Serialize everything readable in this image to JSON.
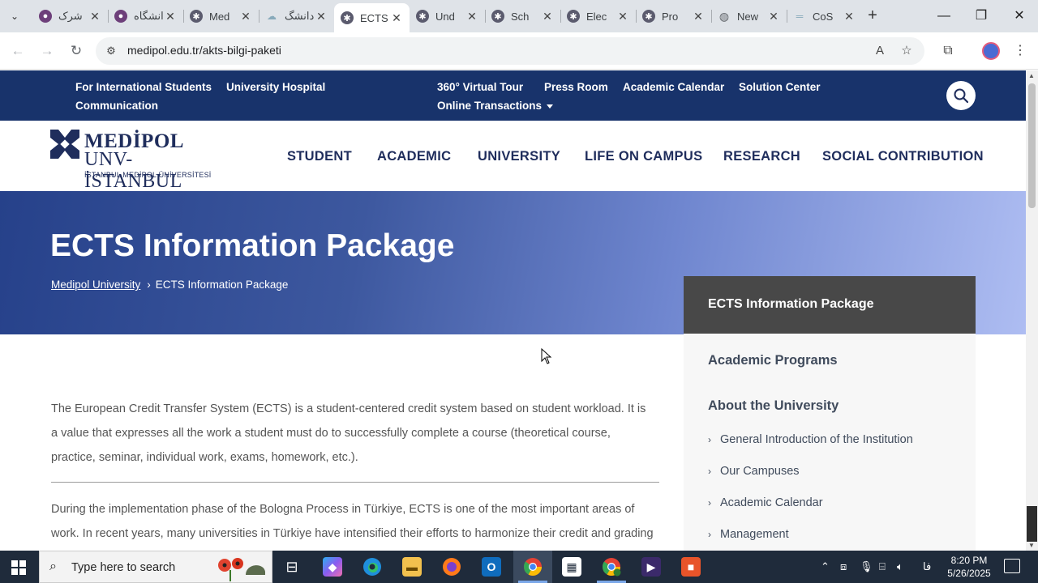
{
  "browser": {
    "tabs": [
      {
        "title": "شرک",
        "favicon": "medipol-purple-icon",
        "active": false
      },
      {
        "title": "دانشگاه",
        "favicon": "medipol-purple-icon",
        "active": false
      },
      {
        "title": "Med",
        "favicon": "medipol-icon",
        "active": false
      },
      {
        "title": "دانشگ",
        "favicon": "generic-page-icon",
        "active": false
      },
      {
        "title": "ECTS",
        "favicon": "medipol-icon",
        "active": true
      },
      {
        "title": "Und",
        "favicon": "medipol-icon",
        "active": false
      },
      {
        "title": "Sch",
        "favicon": "medipol-icon",
        "active": false
      },
      {
        "title": "Elec",
        "favicon": "medipol-icon",
        "active": false
      },
      {
        "title": "Pro",
        "favicon": "medipol-icon",
        "active": false
      },
      {
        "title": "New",
        "favicon": "globe-icon",
        "active": false
      },
      {
        "title": "CoS",
        "favicon": "line-icon",
        "active": false
      }
    ],
    "url": "medipol.edu.tr/akts-bilgi-paketi"
  },
  "site": {
    "topbar": {
      "links": [
        "For International Students",
        "University Hospital",
        "360° Virtual Tour",
        "Press Room",
        "Academic Calendar",
        "Solution Center",
        "Communication",
        "Online Transactions"
      ]
    },
    "logo": {
      "line1": "MEDİPOL",
      "line2": "UNV-İSTANBUL",
      "line3": "İSTANBUL MEDİPOL ÜNİVERSİTESİ"
    },
    "mainnav": [
      "STUDENT",
      "ACADEMIC",
      "UNIVERSITY",
      "LIFE ON CAMPUS",
      "RESEARCH",
      "SOCIAL CONTRIBUTION"
    ],
    "hero": {
      "title": "ECTS Information Package",
      "breadcrumb_home": "Medipol University",
      "breadcrumb_current": "ECTS Information Package"
    },
    "sidebar": {
      "header": "ECTS Information Package",
      "section1": "Academic Programs",
      "section2": "About the University",
      "items": [
        "General Introduction of the Institution",
        "Our Campuses",
        "Academic Calendar",
        "Management"
      ]
    },
    "content": {
      "p1": "The European Credit Transfer System (ECTS) is a student-centered credit system based on student workload. It is a value that expresses all the work a student must do to successfully complete a course (theoretical course, practice, seminar, individual work, exams, homework, etc.).",
      "p2": "During the implementation phase of the Bologna Process in Türkiye, ECTS is one of the most important areas of work. In recent years, many universities in Türkiye have intensified their efforts to harmonize their credit and grading"
    }
  },
  "taskbar": {
    "search_placeholder": "Type here to search",
    "time": "8:20 PM",
    "date": "5/26/2025",
    "lang": "فا"
  },
  "colors": {
    "topbar": "#18336b",
    "navy_text": "#1f2d5c",
    "sidebar_head": "#484848"
  }
}
